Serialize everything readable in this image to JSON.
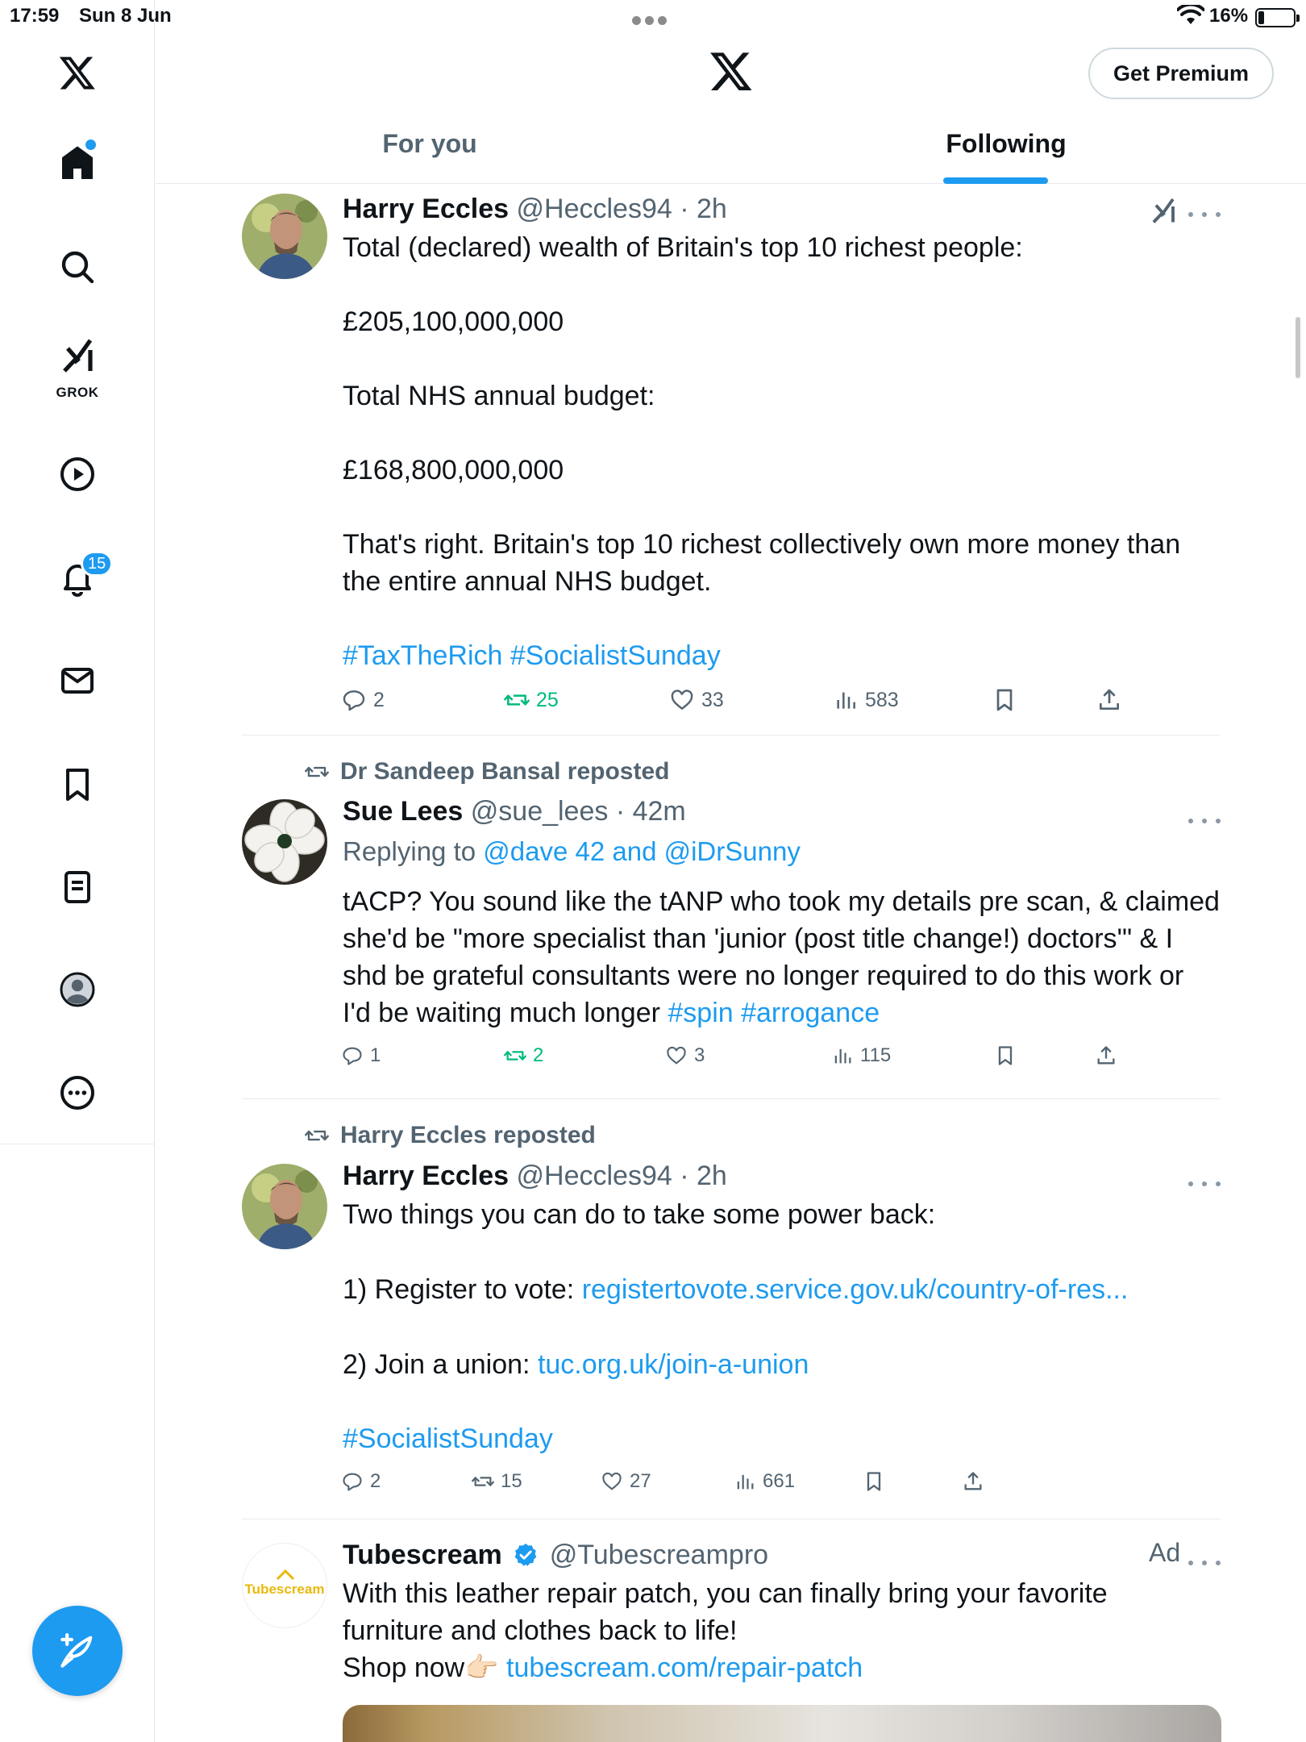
{
  "status_bar": {
    "time": "17:59",
    "date": "Sun 8 Jun",
    "battery": "16%"
  },
  "sidebar": {
    "grok_label": "GROK",
    "notifications_count": "15"
  },
  "header": {
    "premium_label": "Get Premium",
    "tabs": [
      {
        "label": "For you",
        "active": false
      },
      {
        "label": "Following",
        "active": true
      }
    ]
  },
  "posts": [
    {
      "name": "Harry Eccles",
      "handle": "@Heccles94",
      "time": "2h",
      "text": "Total (declared) wealth of Britain's top 10 richest people:\n\n£205,100,000,000\n\nTotal NHS annual budget:\n\n£168,800,000,000\n\nThat's right. Britain's top 10 richest collectively own more money than\nthe entire annual NHS budget.",
      "hashtags": "#TaxTheRich #SocialistSunday",
      "stats": {
        "replies": "2",
        "reposts": "25",
        "likes": "33",
        "views": "583"
      }
    },
    {
      "repost_by": "Dr Sandeep Bansal reposted",
      "name": "Sue Lees",
      "handle": "@sue_lees",
      "time": "42m",
      "replying_prefix": "Replying to ",
      "replying_to": "@dave 42 and @iDrSunny",
      "text": "tACP? You sound like the tANP who took my details pre scan, & claimed\nshe'd be \"more specialist than 'junior (post title change!) doctors'\" & I\nshd be grateful consultants were no longer required to do this work or\nI'd be waiting much longer ",
      "hashtags": "#spin #arrogance",
      "stats": {
        "replies": "1",
        "reposts": "2",
        "likes": "3",
        "views": "115"
      }
    },
    {
      "repost_by": "Harry Eccles reposted",
      "name": "Harry Eccles",
      "handle": "@Heccles94",
      "time": "2h",
      "line1": "Two things you can do to take some power back:",
      "line2_prefix": "1) Register to vote: ",
      "line2_link": "registertovote.service.gov.uk/country-of-res...",
      "line3_prefix": "2) Join a union: ",
      "line3_link": "tuc.org.uk/join-a-union",
      "hashtags": "#SocialistSunday",
      "stats": {
        "replies": "2",
        "reposts": "15",
        "likes": "27",
        "views": "661"
      }
    },
    {
      "name": "Tubescream",
      "handle": "@Tubescreampro",
      "ad_label": "Ad",
      "avatar_text": "Tubescream",
      "text": "With this leather repair patch, you can finally bring your favorite\nfurniture and clothes back to life!",
      "shop_prefix": "Shop now👉🏻 ",
      "shop_link": "tubescream.com/repair-patch"
    }
  ],
  "colors": {
    "accent": "#1d9bf0",
    "muted": "#536471",
    "repost_green": "#00ba7c",
    "text": "#0f1419"
  }
}
